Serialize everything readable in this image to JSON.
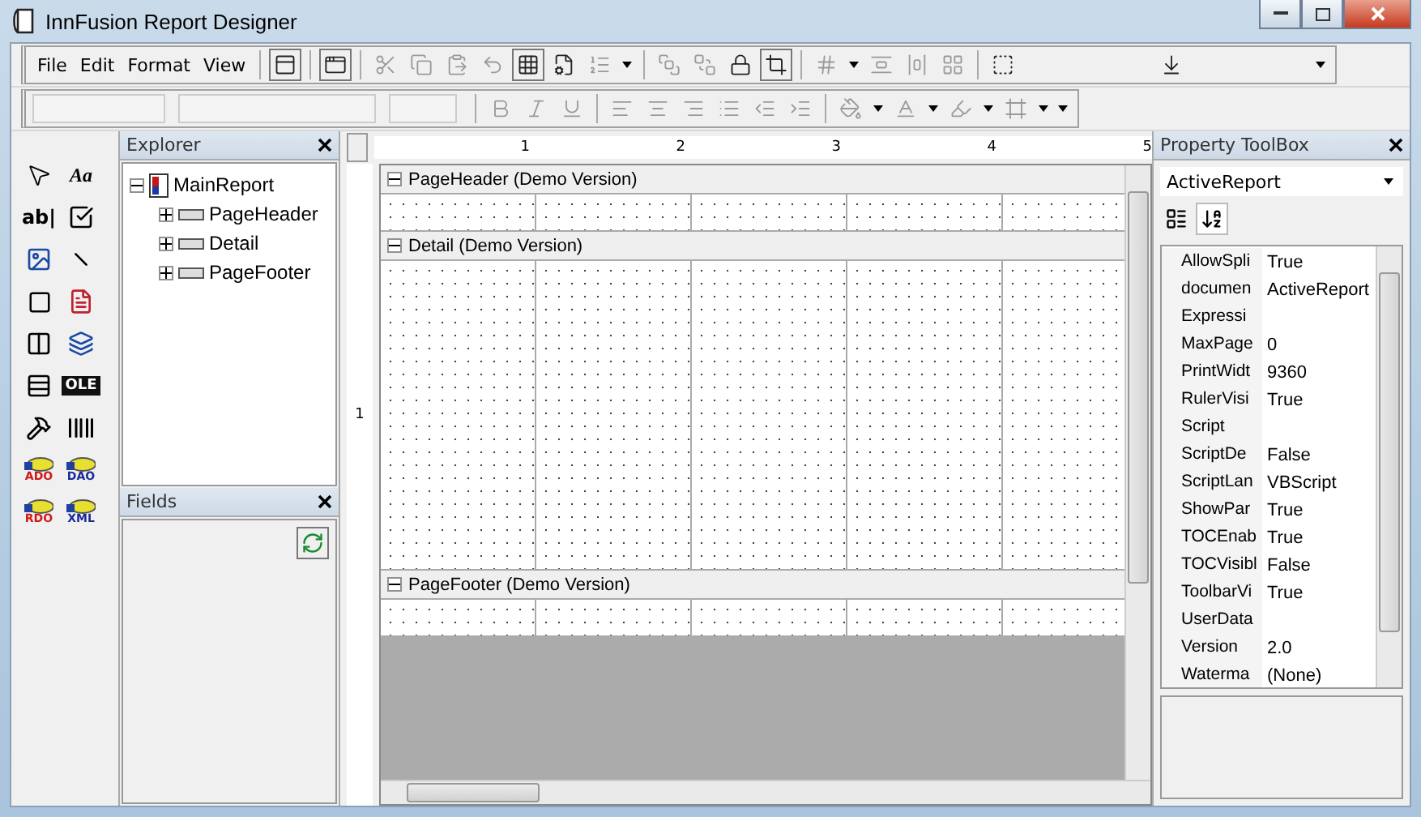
{
  "window": {
    "title": "InnFusion Report Designer"
  },
  "menu": [
    "File",
    "Edit",
    "Format",
    "View"
  ],
  "toolbox": [
    {
      "kind": "pointer"
    },
    {
      "kind": "label",
      "text": "Aa"
    },
    {
      "kind": "textbox",
      "text": "ab|"
    },
    {
      "kind": "checkbox"
    },
    {
      "kind": "picture"
    },
    {
      "kind": "line"
    },
    {
      "kind": "shape"
    },
    {
      "kind": "richtext"
    },
    {
      "kind": "subreport"
    },
    {
      "kind": "frame"
    },
    {
      "kind": "pagebreak"
    },
    {
      "kind": "ole",
      "text": "OLE"
    },
    {
      "kind": "custom"
    },
    {
      "kind": "barcode"
    },
    {
      "kind": "db",
      "text": "ADO"
    },
    {
      "kind": "db",
      "text": "DAO"
    },
    {
      "kind": "db",
      "text": "RDO"
    },
    {
      "kind": "db",
      "text": "XML"
    }
  ],
  "explorer": {
    "title": "Explorer",
    "tree": [
      {
        "label": "MainReport",
        "kind": "report",
        "expanded": true,
        "children": [
          {
            "label": "PageHeader",
            "kind": "section",
            "expanded": false
          },
          {
            "label": "Detail",
            "kind": "section",
            "expanded": false
          },
          {
            "label": "PageFooter",
            "kind": "section",
            "expanded": false
          }
        ]
      }
    ]
  },
  "fields": {
    "title": "Fields"
  },
  "designer": {
    "ruler": [
      "1",
      "2",
      "3",
      "4",
      "5"
    ],
    "vruler": [
      "1"
    ],
    "sections": [
      {
        "title": "PageHeader (Demo Version)",
        "expanded": true,
        "kind": "header"
      },
      {
        "title": "Detail (Demo Version)",
        "expanded": true,
        "kind": "detail"
      },
      {
        "title": "PageFooter (Demo Version)",
        "expanded": true,
        "kind": "footer"
      }
    ]
  },
  "properties": {
    "title": "Property ToolBox",
    "object": "ActiveReport",
    "sort_modes": [
      {
        "kind": "categorized",
        "selected": false
      },
      {
        "kind": "alphabetical",
        "selected": true
      }
    ],
    "rows": [
      {
        "name": "AllowSpli",
        "value": "True"
      },
      {
        "name": "documen",
        "value": "ActiveReport"
      },
      {
        "name": "Expressi"
      },
      {
        "name": "MaxPage",
        "value": "0"
      },
      {
        "name": "PrintWidt",
        "value": "9360"
      },
      {
        "name": "RulerVisi",
        "value": "True"
      },
      {
        "name": "Script"
      },
      {
        "name": "ScriptDe",
        "value": "False"
      },
      {
        "name": "ScriptLan",
        "value": "VBScript"
      },
      {
        "name": "ShowPar",
        "value": "True"
      },
      {
        "name": "TOCEnab",
        "value": "True"
      },
      {
        "name": "TOCVisibl",
        "value": "False"
      },
      {
        "name": "ToolbarVi",
        "value": "True"
      },
      {
        "name": "UserData"
      },
      {
        "name": "Version",
        "value": "2.0"
      },
      {
        "name": "Waterma",
        "value": "(None)"
      }
    ]
  }
}
